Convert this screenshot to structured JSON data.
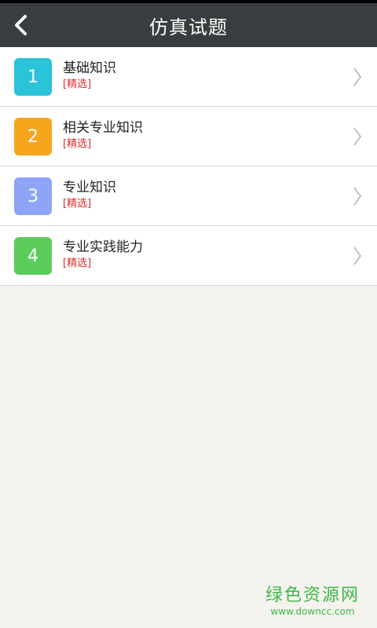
{
  "header": {
    "title": "仿真试题"
  },
  "items": [
    {
      "number": "1",
      "title": "基础知识",
      "tag": "[精选]",
      "color": "#2bc3d8"
    },
    {
      "number": "2",
      "title": "相关专业知识",
      "tag": "[精选]",
      "color": "#f7a51c"
    },
    {
      "number": "3",
      "title": "专业知识",
      "tag": "[精选]",
      "color": "#8ea4f7"
    },
    {
      "number": "4",
      "title": "专业实践能力",
      "tag": "[精选]",
      "color": "#5ccd5c"
    }
  ],
  "watermark": {
    "cn": "绿色资源网",
    "en": "www.downcc.com"
  },
  "icons": {
    "back": "chevron-left-icon",
    "row_arrow": "chevron-right-icon"
  }
}
